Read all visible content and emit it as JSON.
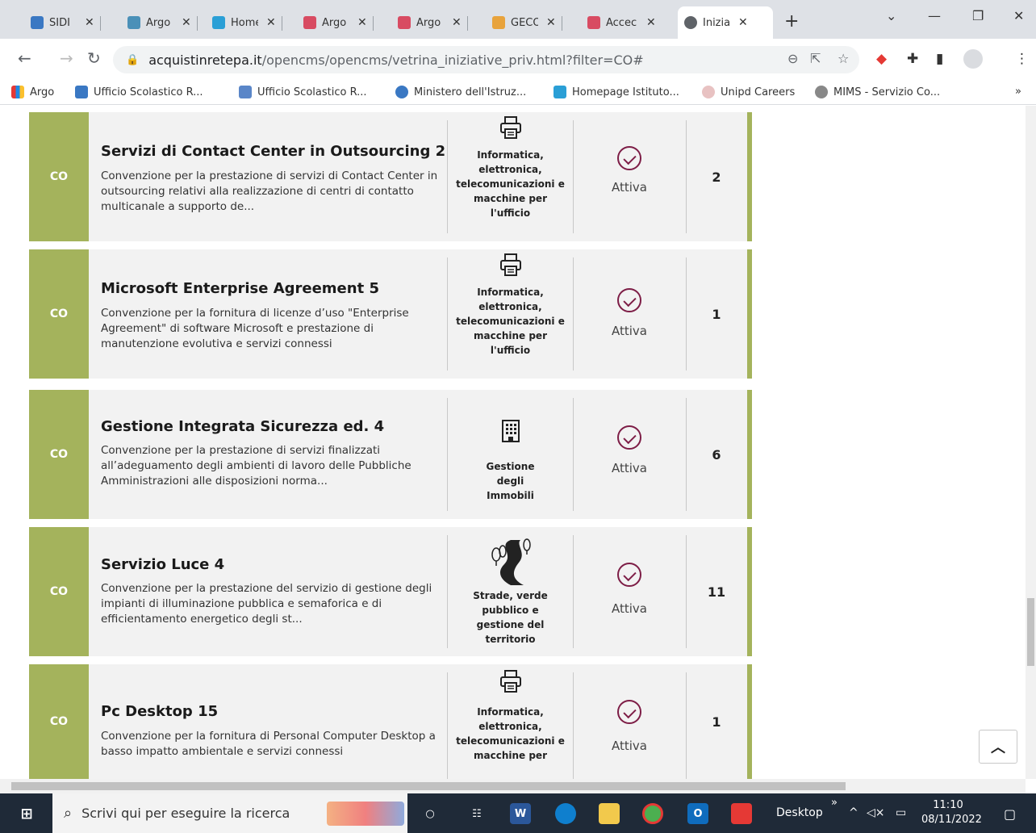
{
  "browser": {
    "tabs": [
      {
        "label": "SIDI",
        "color": "#3a78c3"
      },
      {
        "label": "Argo",
        "color": "#4a90b8"
      },
      {
        "label": "Home",
        "color": "#2a9fd6"
      },
      {
        "label": "Argo",
        "color": "#d84b62"
      },
      {
        "label": "Argo",
        "color": "#d84b62"
      },
      {
        "label": "GECO",
        "color": "#e8a33c"
      },
      {
        "label": "Accec",
        "color": "#d84b62"
      },
      {
        "label": "Inizia",
        "color": "#5f6368"
      }
    ],
    "url_host": "acquistinretepa.it",
    "url_rest": "/opencms/opencms/vetrina_iniziative_priv.html?filter=CO#",
    "bookmarks": [
      "Argo",
      "Ufficio Scolastico R...",
      "Ufficio Scolastico R...",
      "Ministero dell'Istruz...",
      "Homepage Istituto...",
      "Unipd Careers",
      "MIMS - Servizio Co..."
    ],
    "bookmarks_more": "»"
  },
  "icons": {
    "back": "arrow-left-icon",
    "forward": "arrow-right-icon",
    "reload": "reload-icon",
    "printer": "printer-icon",
    "building": "building-icon",
    "road": "road-trees-icon",
    "status": "check-circle-icon"
  },
  "accent_color": "#a4b35c",
  "status_color": "#7d1d46",
  "cards": [
    {
      "code": "CO",
      "title": "Servizi di Contact Center in Outsourcing 2",
      "desc": "Convenzione per la prestazione di servizi di Contact Center in outsourcing relativi alla realizzazione di centri di contatto multicanale a supporto de...",
      "category": "Informatica, elettronica, telecomunicazioni e macchine per l'ufficio",
      "status": "Attiva",
      "count": "2"
    },
    {
      "code": "CO",
      "title": "Microsoft Enterprise Agreement 5",
      "desc": "Convenzione per la fornitura di licenze d’uso \"Enterprise Agreement\" di software Microsoft e prestazione di manutenzione evolutiva e servizi connessi",
      "category": "Informatica, elettronica, telecomunicazioni e macchine per l'ufficio",
      "status": "Attiva",
      "count": "1"
    },
    {
      "code": "CO",
      "title": "Gestione Integrata Sicurezza ed. 4",
      "desc": "Convenzione per la prestazione di servizi finalizzati all’adeguamento degli ambienti di lavoro delle Pubbliche Amministrazioni alle disposizioni norma...",
      "category": "Gestione degli Immobili",
      "status": "Attiva",
      "count": "6"
    },
    {
      "code": "CO",
      "title": "Servizio Luce 4",
      "desc": "Convenzione per la prestazione del servizio di gestione degli impianti di illuminazione pubblica e semaforica e di efficientamento energetico degli st...",
      "category": "Strade, verde pubblico e gestione del territorio",
      "status": "Attiva",
      "count": "11"
    },
    {
      "code": "CO",
      "title": "Pc Desktop 15",
      "desc": "Convenzione per la fornitura di Personal Computer Desktop a basso impatto ambientale e servizi connessi",
      "category": "Informatica, elettronica, telecomunicazioni e macchine per",
      "status": "Attiva",
      "count": "1"
    }
  ],
  "taskbar": {
    "search_placeholder": "Scrivi qui per eseguire la ricerca",
    "desktop_label": "Desktop",
    "time": "11:10",
    "date": "08/11/2022"
  }
}
